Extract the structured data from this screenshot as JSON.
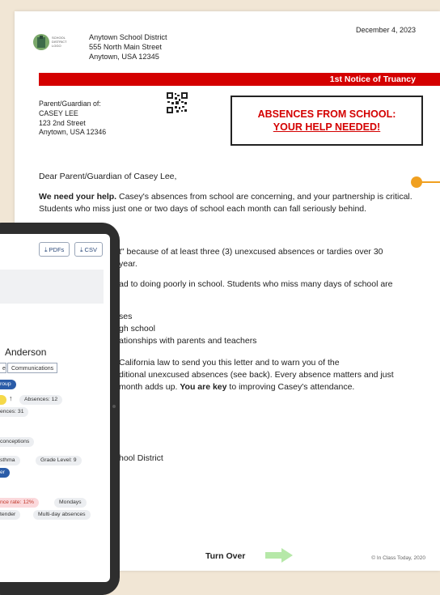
{
  "letter": {
    "date": "December 4, 2023",
    "district_name": "Anytown School District",
    "district_street": "555 North Main Street",
    "district_city": "Anytown, USA 12345",
    "notice_title": "1st Notice of Truancy",
    "parent_label": "Parent/Guardian of:",
    "student_name": "CASEY LEE",
    "student_street": "123 2nd Street",
    "student_city": "Anytown, USA 12346",
    "alert_line1": "ABSENCES FROM SCHOOL:",
    "alert_line2": "YOUR HELP NEEDED!",
    "salutation": "Dear Parent/Guardian of Casey Lee,",
    "para1_bold": "We need your help.",
    "para1_rest": " Casey's absences from school are concerning, and your partnership is critical. Students who miss just one or two days of school each month can fall seriously behind.",
    "frag1": "t\" because of at  least three (3) unexcused absences or tardies over 30",
    "frag2": "year.",
    "frag3": "ad to doing poorly in school. Students who miss many days of school are",
    "frag4": "ses",
    "frag5": "gh school",
    "frag6": "ationships with parents and teachers",
    "frag7": "California law to send you this letter and to warn you of the",
    "frag8": "ditional unexcused absences (see back). Every absence matters and just",
    "frag9a": "month adds up. ",
    "frag9b": "You are key",
    "frag9c": " to improving Casey's attendance.",
    "frag10": "hool District",
    "turn_over": "Turn Over",
    "copyright": "© In Class Today, 2020"
  },
  "tablet": {
    "pdf_label": "PDFs",
    "csv_label": "CSV",
    "student_name": "Anderson",
    "tab_partial": "e",
    "tab_communications": "Communications",
    "group_pill": "roup",
    "absences_pill": "Absences: 12",
    "absences2_pill": "ences: 31",
    "conceptions_pill": "conceptions",
    "asthma_pill": "sthma",
    "grade_pill": "Grade Level: 9",
    "blue_pill2": "er",
    "absence_rate_pill": "nce rate: 12%",
    "mondays_pill": "Mondays",
    "tender_pill": "tender",
    "multiday_pill": "Multi-day absences"
  },
  "colors": {
    "red": "#d40000",
    "orange": "#f0a020",
    "blue": "#2a5ca8",
    "green_arrow": "#9edb8e"
  },
  "icons": {
    "download": "download-icon",
    "arrow": "arrow-right-icon"
  }
}
